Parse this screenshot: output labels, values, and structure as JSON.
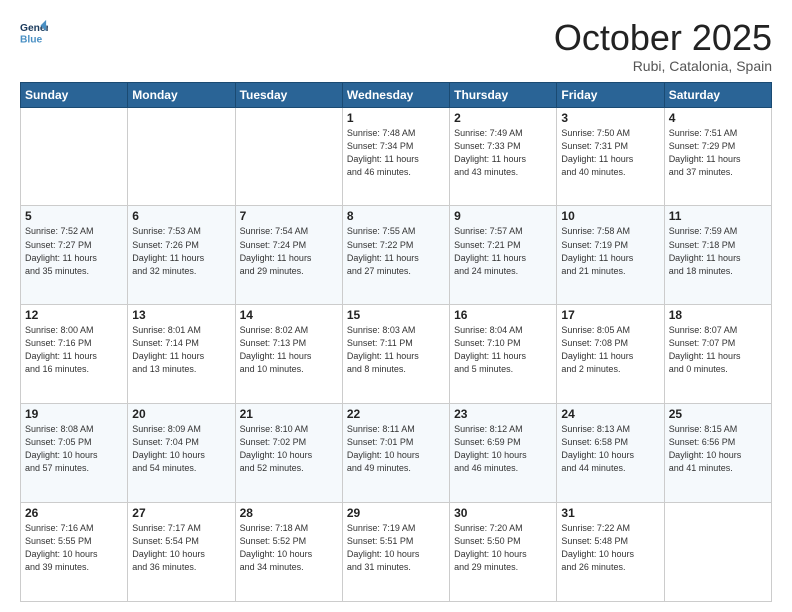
{
  "header": {
    "logo_line1": "General",
    "logo_line2": "Blue",
    "month": "October 2025",
    "location": "Rubi, Catalonia, Spain"
  },
  "days_of_week": [
    "Sunday",
    "Monday",
    "Tuesday",
    "Wednesday",
    "Thursday",
    "Friday",
    "Saturday"
  ],
  "weeks": [
    [
      {
        "day": "",
        "text": ""
      },
      {
        "day": "",
        "text": ""
      },
      {
        "day": "",
        "text": ""
      },
      {
        "day": "1",
        "text": "Sunrise: 7:48 AM\nSunset: 7:34 PM\nDaylight: 11 hours\nand 46 minutes."
      },
      {
        "day": "2",
        "text": "Sunrise: 7:49 AM\nSunset: 7:33 PM\nDaylight: 11 hours\nand 43 minutes."
      },
      {
        "day": "3",
        "text": "Sunrise: 7:50 AM\nSunset: 7:31 PM\nDaylight: 11 hours\nand 40 minutes."
      },
      {
        "day": "4",
        "text": "Sunrise: 7:51 AM\nSunset: 7:29 PM\nDaylight: 11 hours\nand 37 minutes."
      }
    ],
    [
      {
        "day": "5",
        "text": "Sunrise: 7:52 AM\nSunset: 7:27 PM\nDaylight: 11 hours\nand 35 minutes."
      },
      {
        "day": "6",
        "text": "Sunrise: 7:53 AM\nSunset: 7:26 PM\nDaylight: 11 hours\nand 32 minutes."
      },
      {
        "day": "7",
        "text": "Sunrise: 7:54 AM\nSunset: 7:24 PM\nDaylight: 11 hours\nand 29 minutes."
      },
      {
        "day": "8",
        "text": "Sunrise: 7:55 AM\nSunset: 7:22 PM\nDaylight: 11 hours\nand 27 minutes."
      },
      {
        "day": "9",
        "text": "Sunrise: 7:57 AM\nSunset: 7:21 PM\nDaylight: 11 hours\nand 24 minutes."
      },
      {
        "day": "10",
        "text": "Sunrise: 7:58 AM\nSunset: 7:19 PM\nDaylight: 11 hours\nand 21 minutes."
      },
      {
        "day": "11",
        "text": "Sunrise: 7:59 AM\nSunset: 7:18 PM\nDaylight: 11 hours\nand 18 minutes."
      }
    ],
    [
      {
        "day": "12",
        "text": "Sunrise: 8:00 AM\nSunset: 7:16 PM\nDaylight: 11 hours\nand 16 minutes."
      },
      {
        "day": "13",
        "text": "Sunrise: 8:01 AM\nSunset: 7:14 PM\nDaylight: 11 hours\nand 13 minutes."
      },
      {
        "day": "14",
        "text": "Sunrise: 8:02 AM\nSunset: 7:13 PM\nDaylight: 11 hours\nand 10 minutes."
      },
      {
        "day": "15",
        "text": "Sunrise: 8:03 AM\nSunset: 7:11 PM\nDaylight: 11 hours\nand 8 minutes."
      },
      {
        "day": "16",
        "text": "Sunrise: 8:04 AM\nSunset: 7:10 PM\nDaylight: 11 hours\nand 5 minutes."
      },
      {
        "day": "17",
        "text": "Sunrise: 8:05 AM\nSunset: 7:08 PM\nDaylight: 11 hours\nand 2 minutes."
      },
      {
        "day": "18",
        "text": "Sunrise: 8:07 AM\nSunset: 7:07 PM\nDaylight: 11 hours\nand 0 minutes."
      }
    ],
    [
      {
        "day": "19",
        "text": "Sunrise: 8:08 AM\nSunset: 7:05 PM\nDaylight: 10 hours\nand 57 minutes."
      },
      {
        "day": "20",
        "text": "Sunrise: 8:09 AM\nSunset: 7:04 PM\nDaylight: 10 hours\nand 54 minutes."
      },
      {
        "day": "21",
        "text": "Sunrise: 8:10 AM\nSunset: 7:02 PM\nDaylight: 10 hours\nand 52 minutes."
      },
      {
        "day": "22",
        "text": "Sunrise: 8:11 AM\nSunset: 7:01 PM\nDaylight: 10 hours\nand 49 minutes."
      },
      {
        "day": "23",
        "text": "Sunrise: 8:12 AM\nSunset: 6:59 PM\nDaylight: 10 hours\nand 46 minutes."
      },
      {
        "day": "24",
        "text": "Sunrise: 8:13 AM\nSunset: 6:58 PM\nDaylight: 10 hours\nand 44 minutes."
      },
      {
        "day": "25",
        "text": "Sunrise: 8:15 AM\nSunset: 6:56 PM\nDaylight: 10 hours\nand 41 minutes."
      }
    ],
    [
      {
        "day": "26",
        "text": "Sunrise: 7:16 AM\nSunset: 5:55 PM\nDaylight: 10 hours\nand 39 minutes."
      },
      {
        "day": "27",
        "text": "Sunrise: 7:17 AM\nSunset: 5:54 PM\nDaylight: 10 hours\nand 36 minutes."
      },
      {
        "day": "28",
        "text": "Sunrise: 7:18 AM\nSunset: 5:52 PM\nDaylight: 10 hours\nand 34 minutes."
      },
      {
        "day": "29",
        "text": "Sunrise: 7:19 AM\nSunset: 5:51 PM\nDaylight: 10 hours\nand 31 minutes."
      },
      {
        "day": "30",
        "text": "Sunrise: 7:20 AM\nSunset: 5:50 PM\nDaylight: 10 hours\nand 29 minutes."
      },
      {
        "day": "31",
        "text": "Sunrise: 7:22 AM\nSunset: 5:48 PM\nDaylight: 10 hours\nand 26 minutes."
      },
      {
        "day": "",
        "text": ""
      }
    ]
  ]
}
